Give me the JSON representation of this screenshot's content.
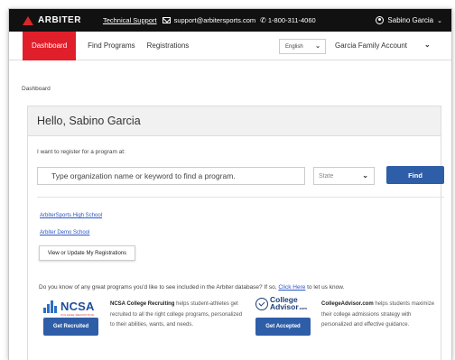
{
  "topbar": {
    "brand": "ARBITER",
    "support_label": "Technical Support",
    "email": "support@arbitersports.com",
    "phone": "1-800-311-4060",
    "user_name": "Sabino Garcia"
  },
  "nav": {
    "items": [
      "Dashboard",
      "Find Programs",
      "Registrations"
    ],
    "language": "English",
    "account": "Garcia Family Account"
  },
  "breadcrumb": "Dashboard",
  "card": {
    "greeting": "Hello, Sabino Garcia",
    "intro": "I want to register for a program at:",
    "search_placeholder": "Type organization name or keyword to find a program.",
    "state_placeholder": "State",
    "find_label": "Find",
    "orgs": [
      "ArbiterSports High School",
      "Arbiter Demo School"
    ],
    "view_label": "View or Update My Registrations",
    "promo_before": "Do you know of any great programs you'd like to see included in the Arbiter database? If so, ",
    "promo_link": "Click Here",
    "promo_after": " to let us know."
  },
  "ncsa": {
    "logo": "NCSA",
    "logo_sub": "COLLEGE RECRUITING",
    "button": "Get Recruited",
    "name": "NCSA College Recruiting",
    "desc": " helps student-athletes get recruited to all the right college programs, personalized to their abilities, wants, and needs."
  },
  "college_advisor": {
    "logo_line1": "College",
    "logo_line2": "Advisor",
    "logo_com": ".com",
    "button": "Get Accepted",
    "name": "CollegeAdvisor.com",
    "desc": " helps students maximize their college admissions strategy with personalized and effective guidance."
  },
  "colors": {
    "accent_red": "#e11f2b",
    "button_blue": "#2f5ea8",
    "link_blue": "#2a56c6"
  },
  "icons": [
    "arbiter-logo-icon",
    "mail-icon",
    "phone-icon",
    "user-circle-icon",
    "chevron-down-icon",
    "ncsa-logo-icon",
    "college-advisor-logo-icon"
  ]
}
